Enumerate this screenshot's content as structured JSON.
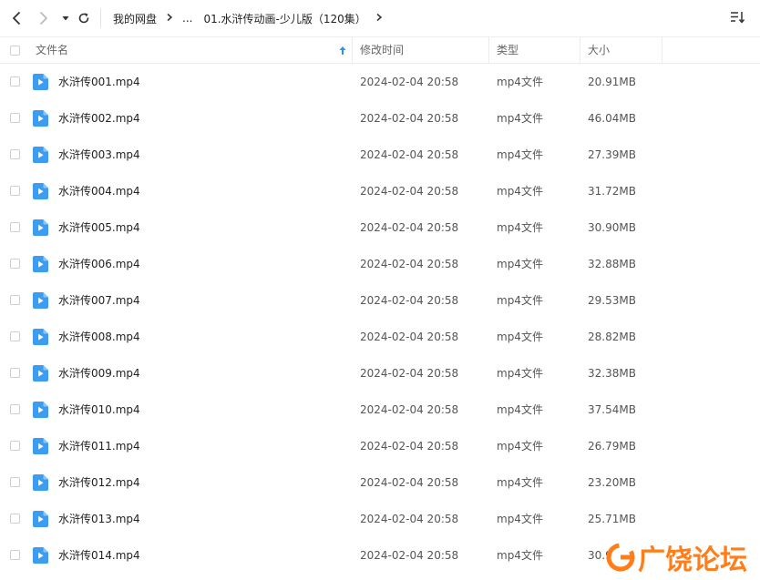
{
  "toolbar": {
    "breadcrumb": {
      "root": "我的网盘",
      "ellipsis": "...",
      "current": "01.水浒传动画-少儿版（120集）"
    }
  },
  "columns": {
    "name": "文件名",
    "time": "修改时间",
    "type": "类型",
    "size": "大小"
  },
  "files": [
    {
      "name": "水浒传001.mp4",
      "time": "2024-02-04 20:58",
      "type": "mp4文件",
      "size": "20.91MB"
    },
    {
      "name": "水浒传002.mp4",
      "time": "2024-02-04 20:58",
      "type": "mp4文件",
      "size": "46.04MB"
    },
    {
      "name": "水浒传003.mp4",
      "time": "2024-02-04 20:58",
      "type": "mp4文件",
      "size": "27.39MB"
    },
    {
      "name": "水浒传004.mp4",
      "time": "2024-02-04 20:58",
      "type": "mp4文件",
      "size": "31.72MB"
    },
    {
      "name": "水浒传005.mp4",
      "time": "2024-02-04 20:58",
      "type": "mp4文件",
      "size": "30.90MB"
    },
    {
      "name": "水浒传006.mp4",
      "time": "2024-02-04 20:58",
      "type": "mp4文件",
      "size": "32.88MB"
    },
    {
      "name": "水浒传007.mp4",
      "time": "2024-02-04 20:58",
      "type": "mp4文件",
      "size": "29.53MB"
    },
    {
      "name": "水浒传008.mp4",
      "time": "2024-02-04 20:58",
      "type": "mp4文件",
      "size": "28.82MB"
    },
    {
      "name": "水浒传009.mp4",
      "time": "2024-02-04 20:58",
      "type": "mp4文件",
      "size": "32.38MB"
    },
    {
      "name": "水浒传010.mp4",
      "time": "2024-02-04 20:58",
      "type": "mp4文件",
      "size": "37.54MB"
    },
    {
      "name": "水浒传011.mp4",
      "time": "2024-02-04 20:58",
      "type": "mp4文件",
      "size": "26.79MB"
    },
    {
      "name": "水浒传012.mp4",
      "time": "2024-02-04 20:58",
      "type": "mp4文件",
      "size": "23.20MB"
    },
    {
      "name": "水浒传013.mp4",
      "time": "2024-02-04 20:58",
      "type": "mp4文件",
      "size": "25.71MB"
    },
    {
      "name": "水浒传014.mp4",
      "time": "2024-02-04 20:58",
      "type": "mp4文件",
      "size": "30.9"
    }
  ],
  "watermark": {
    "text": "广饶论坛"
  },
  "colors": {
    "accent": "#3b8cf0",
    "file_icon": "#3b9cf2",
    "watermark": "#ff7e1a",
    "border": "#ededed"
  },
  "icons": {
    "back": "chevron-left-icon",
    "forward": "chevron-right-icon",
    "history": "caret-down-icon",
    "refresh": "refresh-icon",
    "sort": "sort-icon",
    "sort_indicator": "arrow-up-icon",
    "file": "video-file-icon"
  }
}
